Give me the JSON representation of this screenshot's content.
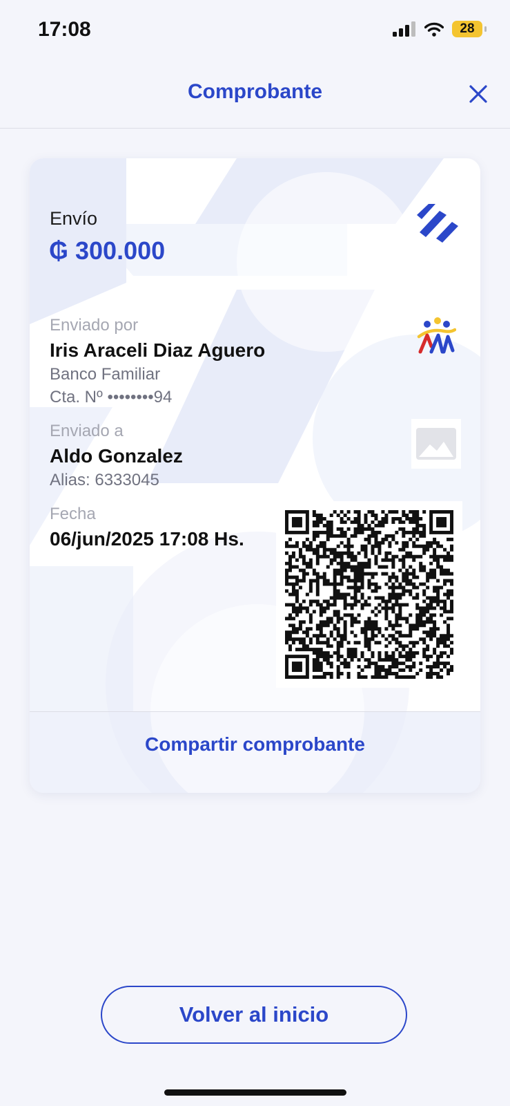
{
  "status_bar": {
    "time": "17:08",
    "battery": "28"
  },
  "header": {
    "title": "Comprobante",
    "close_icon": "close-icon"
  },
  "receipt": {
    "type_label": "Envío",
    "amount": "₲ 300.000",
    "sender": {
      "label": "Enviado por",
      "name": "Iris Araceli Diaz Aguero",
      "bank": "Banco Familiar",
      "account": "Cta. Nº ••••••••94"
    },
    "recipient": {
      "label": "Enviado a",
      "name": "Aldo Gonzalez",
      "alias": "Alias: 6333045"
    },
    "date": {
      "label": "Fecha",
      "value": "06/jun/2025  17:08 Hs."
    },
    "share_label": "Compartir comprobante"
  },
  "footer": {
    "home_button": "Volver al inicio"
  },
  "colors": {
    "accent": "#2b47c9",
    "background": "#f4f5fb",
    "battery": "#f4c430"
  }
}
